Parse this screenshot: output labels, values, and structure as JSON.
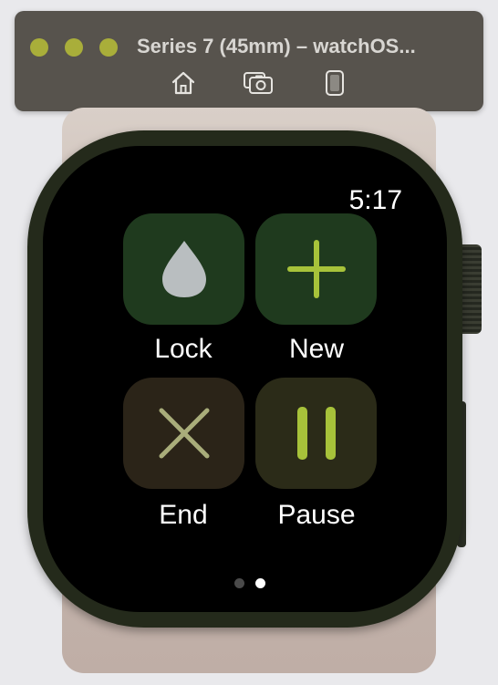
{
  "window": {
    "title": "Series 7 (45mm) – watchOS...",
    "toolbar": [
      {
        "name": "home-icon",
        "label": "Home"
      },
      {
        "name": "screenshot-icon",
        "label": "Screenshot"
      },
      {
        "name": "rotate-device-icon",
        "label": "Rotate"
      }
    ]
  },
  "watch": {
    "time": "5:17",
    "buttons": [
      {
        "label": "Lock",
        "icon": "water-drop-icon",
        "bg": "#1f3a1e",
        "icon_color": "#b9bec0"
      },
      {
        "label": "New",
        "icon": "plus-icon",
        "bg": "#1f3a1e",
        "icon_color": "#a7c23a"
      },
      {
        "label": "End",
        "icon": "x-icon",
        "bg": "#2b2418",
        "icon_color": "#a9ad7a"
      },
      {
        "label": "Pause",
        "icon": "pause-icon",
        "bg": "#2b2b18",
        "icon_color": "#a7c23a"
      }
    ],
    "page_dots": {
      "count": 2,
      "active_index": 1,
      "active_color": "#ffffff",
      "inactive_color": "#4a4a4a"
    }
  },
  "colors": {
    "titlebar": "#57534d",
    "traffic_light": "#a9ae3a",
    "case": "#242a1b"
  }
}
